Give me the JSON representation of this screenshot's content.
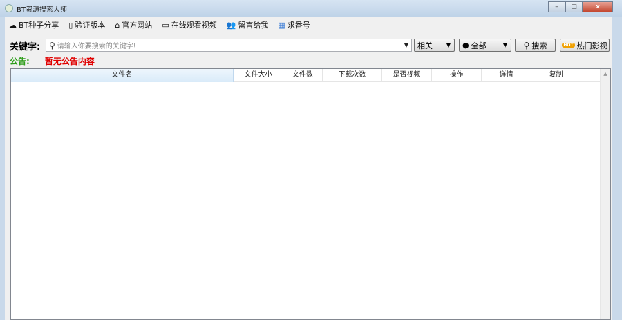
{
  "window": {
    "title": "BT资源搜索大师",
    "minimize": "–",
    "maximize": "□",
    "close": "x"
  },
  "menu": [
    {
      "icon": "cloud-upload-icon",
      "glyph": "☁",
      "label": "BT种子分享"
    },
    {
      "icon": "document-lock-icon",
      "glyph": "▯",
      "label": "验证版本"
    },
    {
      "icon": "home-icon",
      "glyph": "⌂",
      "label": "官方网站"
    },
    {
      "icon": "monitor-icon",
      "glyph": "▭",
      "label": "在线观看视频"
    },
    {
      "icon": "users-icon",
      "glyph": "👥",
      "label": "留言给我"
    },
    {
      "icon": "app-icon",
      "glyph": "▦",
      "label": "求番号"
    }
  ],
  "search": {
    "label": "关键字:",
    "placeholder": "请输入你要搜索的关键字!",
    "sort": "相关",
    "filter": "全部",
    "search_button": "搜索",
    "hot_badge": "HOT",
    "hot_button": "热门影视"
  },
  "notice": {
    "label": "公告:",
    "text": "暂无公告内容"
  },
  "table": {
    "columns": [
      "文件名",
      "文件大小",
      "文件数",
      "下载次数",
      "是否视频",
      "操作",
      "详情",
      "复制"
    ]
  }
}
